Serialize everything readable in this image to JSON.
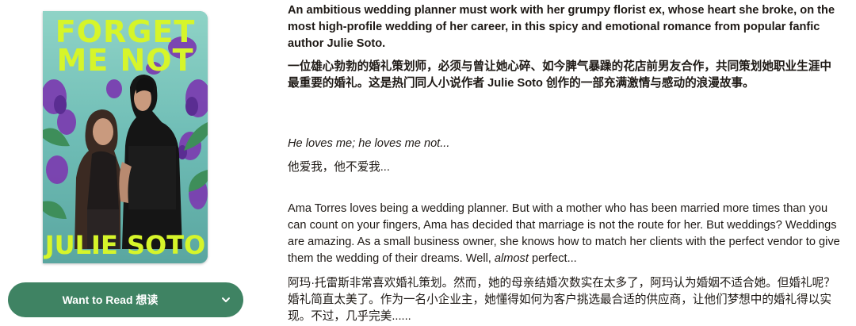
{
  "book": {
    "cover_title": "FORGET ME NOT",
    "cover_author": "JULIE SOTO"
  },
  "shelf_button": {
    "label": "Want to Read  想读",
    "chevron_icon": "chevron-down-icon",
    "color": "#3f8363"
  },
  "description": {
    "p1_en": "An ambitious wedding planner must work with her grumpy florist ex, whose heart she broke, on the most high-profile wedding of her career, in this spicy and emotional romance from popular fanfic author Julie Soto.",
    "p1_zh": "一位雄心勃勃的婚礼策划师，必须与曾让她心碎、如今脾气暴躁的花店前男友合作，共同策划她职业生涯中最重要的婚礼。这是热门同人小说作者 Julie Soto 创作的一部充满激情与感动的浪漫故事。",
    "p2_en": "He loves me; he loves me not...",
    "p2_zh": "他爱我，他不爱我...",
    "p3_en_before": "Ama Torres loves being a wedding planner. But with a mother who has been married more times than you can count on your fingers, Ama has decided that marriage is not the route for her. But weddings? Weddings are amazing. As a small business owner, she knows how to match her clients with the perfect vendor to give them the wedding of their dreams. Well, ",
    "p3_en_em": "almost",
    "p3_en_after": " perfect...",
    "p3_zh": "阿玛·托雷斯非常喜欢婚礼策划。然而，她的母亲结婚次数实在太多了，阿玛认为婚姻不适合她。但婚礼呢？婚礼简直太美了。作为一名小企业主，她懂得如何为客户挑选最合适的供应商，让他们梦想中的婚礼得以实现。不过，几乎完美......"
  }
}
